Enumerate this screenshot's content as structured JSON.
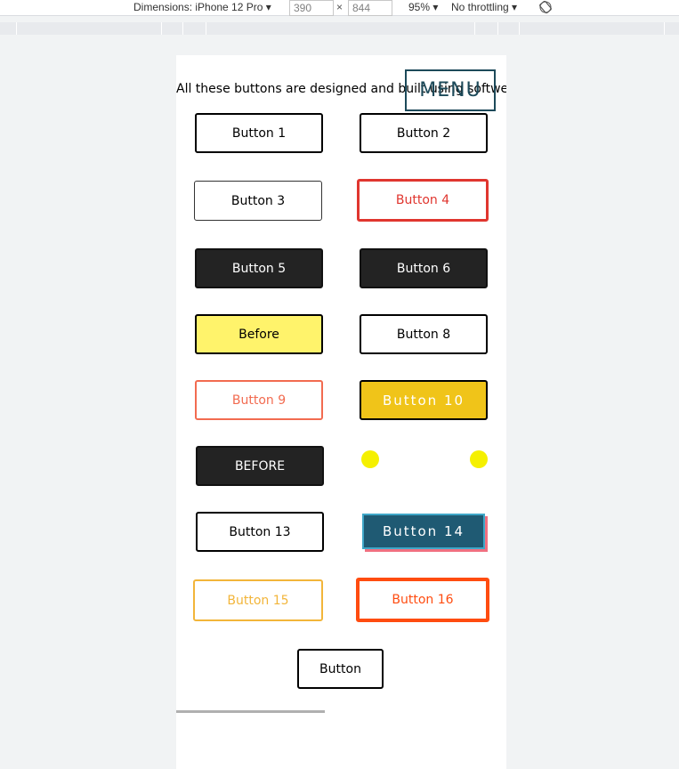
{
  "devtools": {
    "dimensions_label": "Dimensions: iPhone 12 Pro ▾",
    "width_value": "390",
    "times": "×",
    "height_value": "844",
    "zoom": "95% ▾",
    "throttle": "No throttling ▾",
    "rotate_icon": "rotate-icon"
  },
  "page": {
    "intro_text": "All these buttons are designed and built using softwe",
    "menu_label": "MENU",
    "buttons": {
      "b1": "Button 1",
      "b2": "Button 2",
      "b3": "Button 3",
      "b4": "Button 4",
      "b5": "Button 5",
      "b6": "Button 6",
      "b7": "Before",
      "b8": "Button 8",
      "b9": "Button 9",
      "b10": "Button 10",
      "b11": "BEFORE",
      "b13": "Button 13",
      "b14": "Button 14",
      "b15": "Button 15",
      "b16": "Button 16",
      "b17": "Button"
    }
  },
  "colors": {
    "red": "#e0362f",
    "dark": "#232323",
    "yellow": "#fff36b",
    "coral": "#f26b50",
    "gold": "#f0c419",
    "teal": "#1f5a73",
    "amber": "#f2b53a",
    "orange": "#ff4c10",
    "dot_yellow": "#f5f000"
  }
}
